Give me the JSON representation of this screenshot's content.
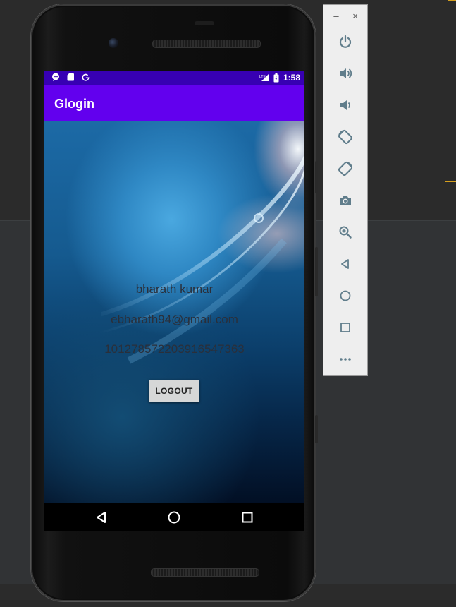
{
  "emulator": {
    "app": {
      "title": "Glogin",
      "user_name": "bharath kumar",
      "user_email": "ebharath94@gmail.com",
      "user_id": "101278572203916547363",
      "logout_label": "LOGOUT"
    },
    "status_bar": {
      "time": "1:58",
      "network": "LTE",
      "left_icons": [
        "message-icon",
        "sd-card-icon",
        "google-icon"
      ],
      "right_icons": [
        "lte-signal-icon",
        "battery-icon"
      ]
    },
    "nav_bar": {
      "buttons": [
        "back-icon",
        "home-icon",
        "recents-icon"
      ]
    },
    "side_panel": {
      "window_controls": [
        "–",
        "×"
      ],
      "buttons": [
        "power-icon",
        "volume-up-icon",
        "volume-down-icon",
        "rotate-left-icon",
        "rotate-right-icon",
        "camera-icon",
        "zoom-icon",
        "back-icon",
        "home-icon",
        "overview-icon",
        "more-icon"
      ]
    }
  },
  "colors": {
    "status_bar": "#3700b3",
    "app_bar": "#6200ee",
    "ide_background": "#2b2b2b",
    "accent": "#d6a01e"
  }
}
